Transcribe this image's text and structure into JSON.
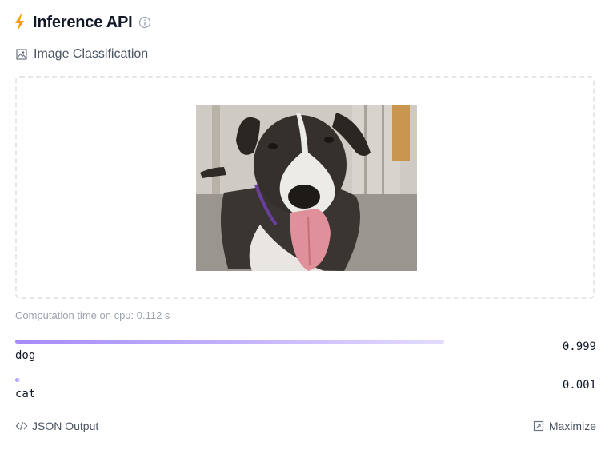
{
  "header": {
    "title": "Inference API",
    "bolt_color": "#f59e0b",
    "icons": [
      "lightning-icon",
      "info-icon"
    ]
  },
  "task": {
    "label": "Image Classification",
    "icon": "image-classification-icon"
  },
  "dropzone": {
    "image_description": "dog"
  },
  "computation": {
    "text": "Computation time on cpu: 0.112 s"
  },
  "results": [
    {
      "label": "dog",
      "score_text": "0.999",
      "score": 0.999
    },
    {
      "label": "cat",
      "score_text": "0.001",
      "score": 0.001
    }
  ],
  "footer": {
    "json_label": "JSON Output",
    "maximize_label": "Maximize"
  },
  "colors": {
    "bar_gradient_start": "#a78bfa",
    "bar_gradient_end": "#e4dcfd",
    "muted_text": "#9ca3af"
  }
}
